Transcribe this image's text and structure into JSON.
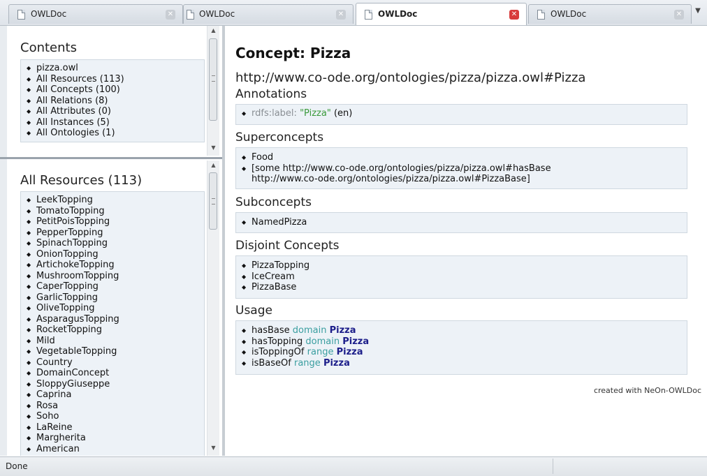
{
  "tabs": [
    {
      "label": "OWLDoc",
      "active": false
    },
    {
      "label": "OWLDoc",
      "active": false
    },
    {
      "label": "OWLDoc",
      "active": true
    },
    {
      "label": "OWLDoc",
      "active": false
    }
  ],
  "contents": {
    "title": "Contents",
    "items": [
      "pizza.owl",
      "All Resources (113)",
      "All Concepts (100)",
      "All Relations (8)",
      "All Attributes (0)",
      "All Instances (5)",
      "All Ontologies (1)"
    ]
  },
  "resources": {
    "title": "All Resources (113)",
    "items": [
      "LeekTopping",
      "TomatoTopping",
      "PetitPoisTopping",
      "PepperTopping",
      "SpinachTopping",
      "OnionTopping",
      "ArtichokeTopping",
      "MushroomTopping",
      "CaperTopping",
      "GarlicTopping",
      "OliveTopping",
      "AsparagusTopping",
      "RocketTopping",
      "Mild",
      "VegetableTopping",
      "Country",
      "DomainConcept",
      "SloppyGiuseppe",
      "Caprina",
      "Rosa",
      "Soho",
      "LaReine",
      "Margherita",
      "American"
    ]
  },
  "main": {
    "title": "Concept: Pizza",
    "uri": "http://www.co-ode.org/ontologies/pizza/pizza.owl#Pizza",
    "annotations": {
      "heading": "Annotations",
      "prop": "rdfs:label:",
      "value": "\"Pizza\"",
      "lang": "(en)"
    },
    "superconcepts": {
      "heading": "Superconcepts",
      "items": [
        "Food",
        "[some http://www.co-ode.org/ontologies/pizza/pizza.owl#hasBase",
        "http://www.co-ode.org/ontologies/pizza/pizza.owl#PizzaBase]"
      ]
    },
    "subconcepts": {
      "heading": "Subconcepts",
      "items": [
        "NamedPizza"
      ]
    },
    "disjoint": {
      "heading": "Disjoint Concepts",
      "items": [
        "PizzaTopping",
        "IceCream",
        "PizzaBase"
      ]
    },
    "usage": {
      "heading": "Usage",
      "items": [
        {
          "rel": "hasBase",
          "kind": "domain",
          "target": "Pizza"
        },
        {
          "rel": "hasTopping",
          "kind": "domain",
          "target": "Pizza"
        },
        {
          "rel": "isToppingOf",
          "kind": "range",
          "target": "Pizza"
        },
        {
          "rel": "isBaseOf",
          "kind": "range",
          "target": "Pizza"
        }
      ]
    },
    "footer": "created with NeOn-OWLDoc"
  },
  "status": {
    "text": "Done"
  },
  "icons": {
    "tab_doc": "document-icon",
    "tab_close": "close-icon",
    "tab_list": "chevron-down-icon"
  },
  "colors": {
    "box_bg": "#edf2f7",
    "active_close": "#d83c3c",
    "link_green": "#3a9a3a",
    "keyword_teal": "#3a9ea0",
    "target_navy": "#1c1e8a"
  }
}
